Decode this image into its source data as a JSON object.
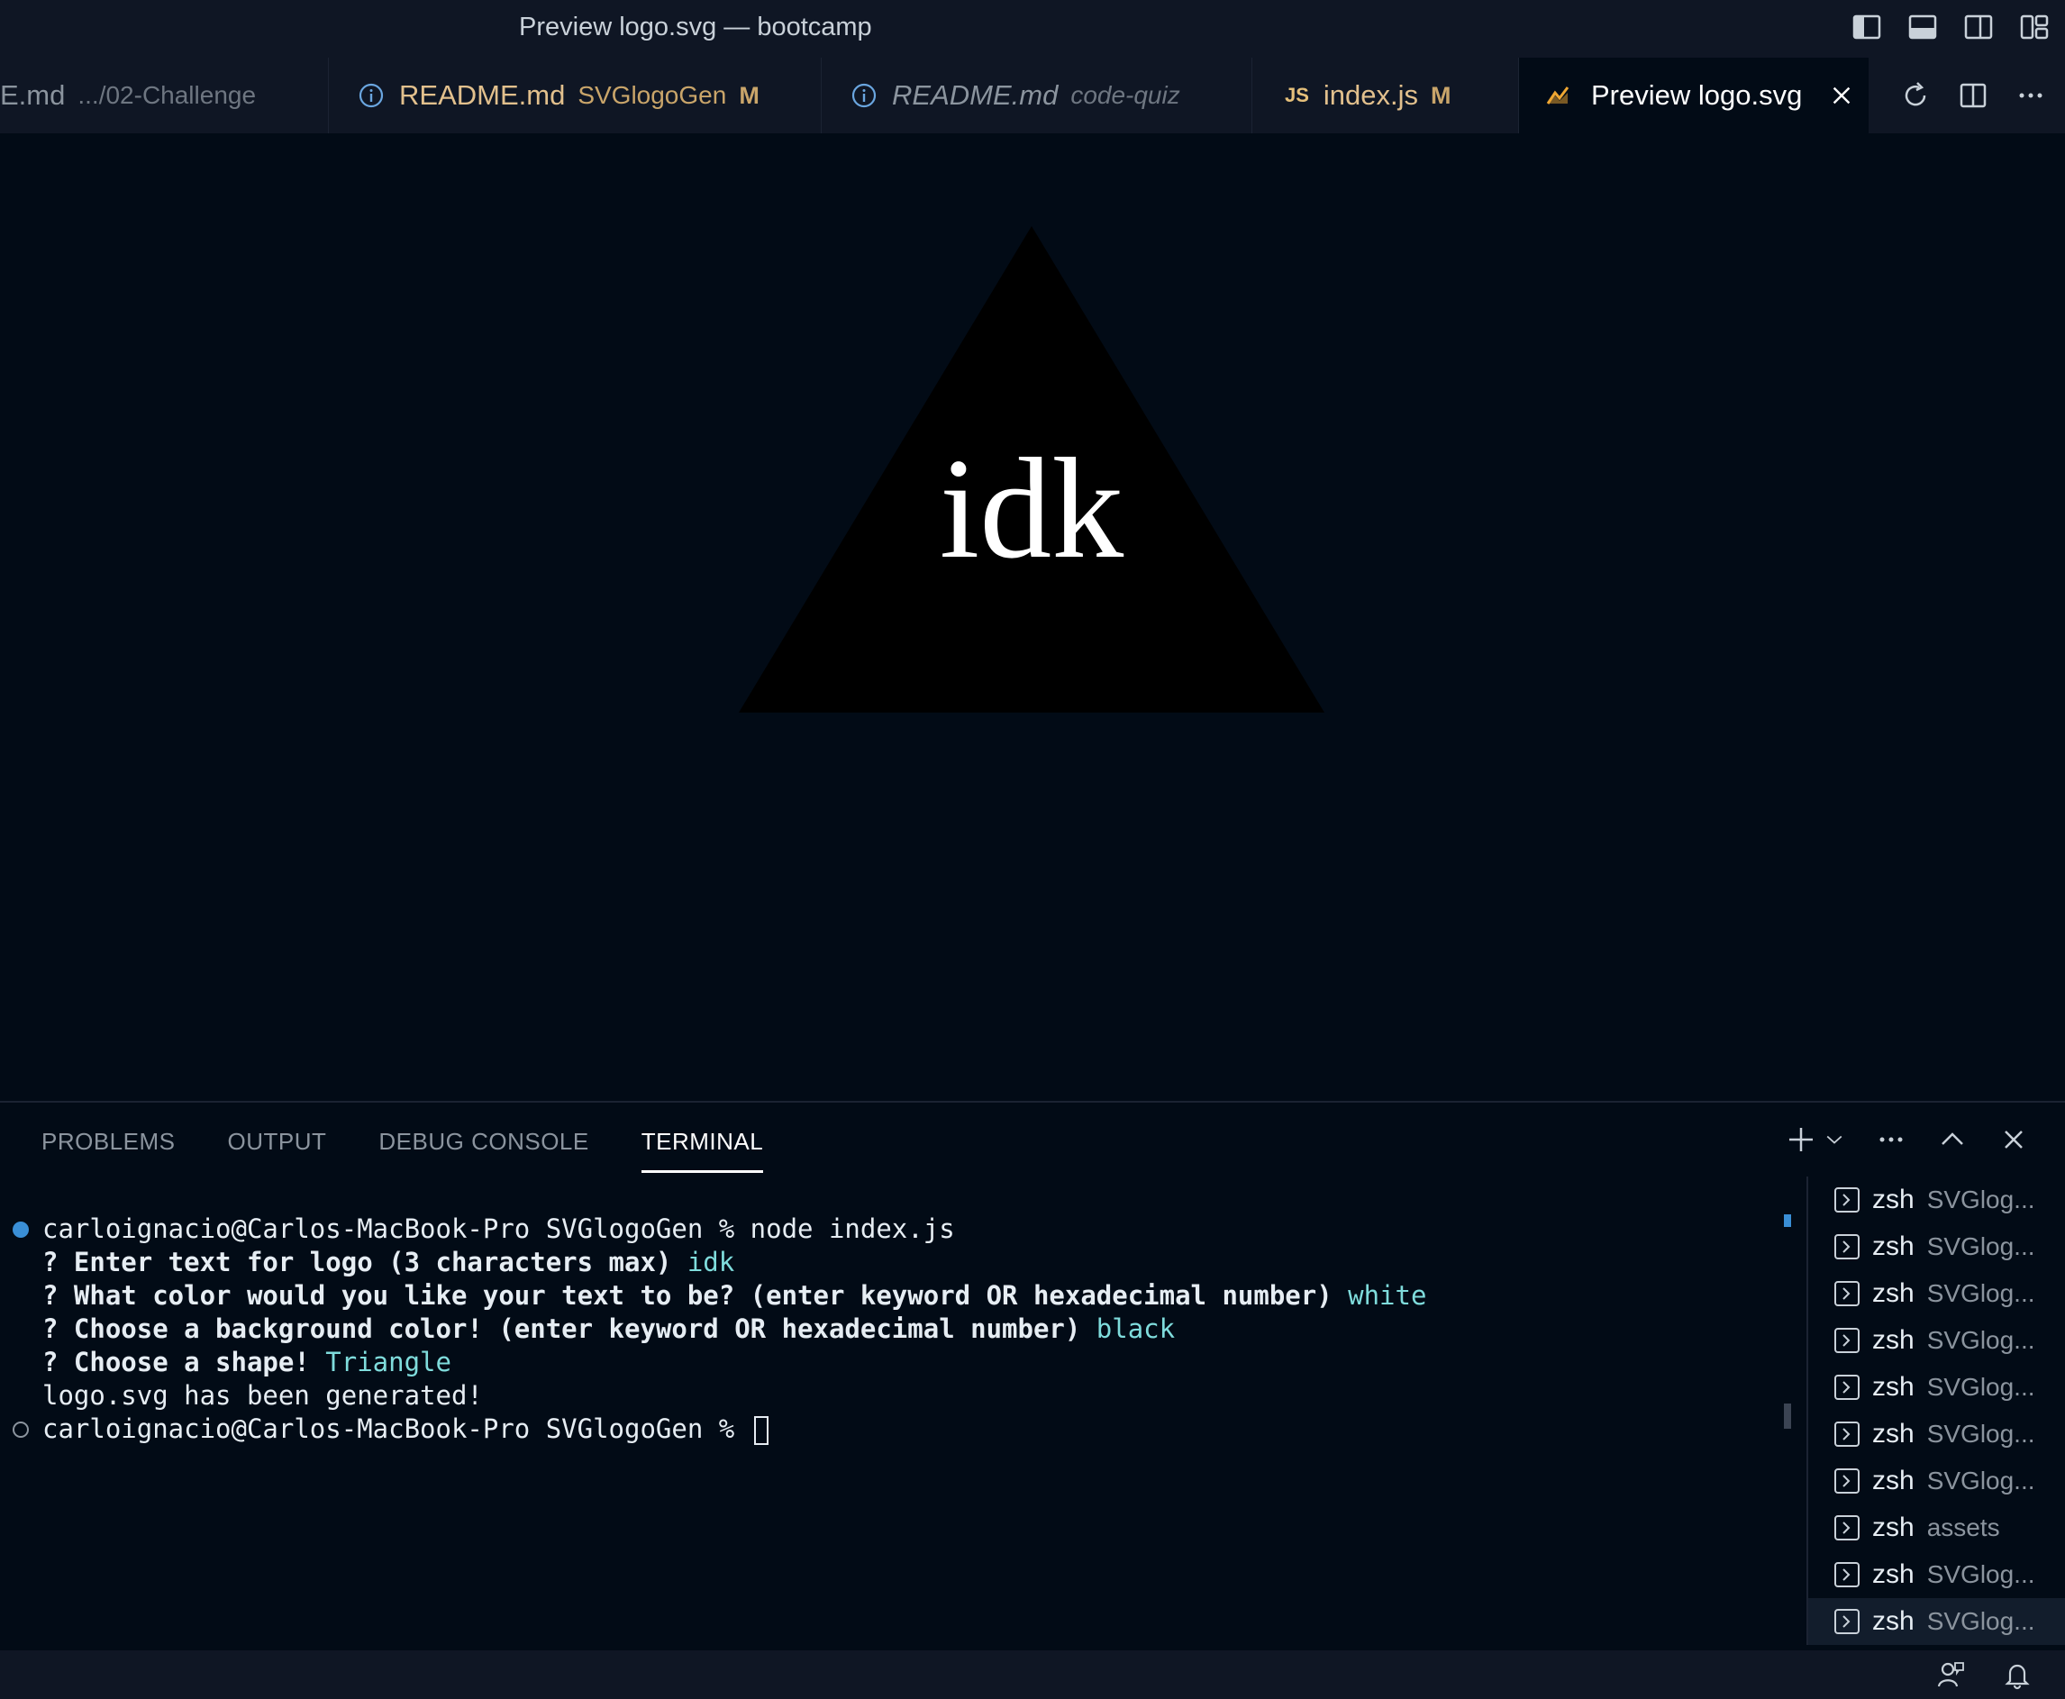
{
  "window": {
    "title": "Preview logo.svg — bootcamp",
    "layout_icons": [
      "toggle-primary-sidebar-icon",
      "toggle-panel-icon",
      "toggle-secondary-sidebar-icon",
      "customize-layout-icon"
    ]
  },
  "tabs": [
    {
      "name": "E.md",
      "desc": ".../02-Challenge",
      "modified": "",
      "icon": "none",
      "active": false,
      "italic": false
    },
    {
      "name": "README.md",
      "desc": "SVGlogoGen",
      "modified": "M",
      "icon": "info-icon",
      "active": false,
      "italic": false
    },
    {
      "name": "README.md",
      "desc": "code-quiz",
      "modified": "",
      "icon": "info-icon",
      "active": false,
      "italic": true
    },
    {
      "name": "index.js",
      "desc": "",
      "modified": "M",
      "icon": "js-icon",
      "icon_label": "JS",
      "active": false,
      "italic": false
    },
    {
      "name": "Preview logo.svg",
      "desc": "",
      "modified": "",
      "icon": "preview-icon",
      "active": true,
      "italic": false
    }
  ],
  "tab_actions": [
    "refresh-icon",
    "split-editor-icon",
    "more-actions-icon"
  ],
  "preview": {
    "logo_text": "idk",
    "shape": "Triangle",
    "shape_color": "#000000",
    "text_color": "#ffffff"
  },
  "panel": {
    "tabs": [
      "PROBLEMS",
      "OUTPUT",
      "DEBUG CONSOLE",
      "TERMINAL"
    ],
    "active_tab": "TERMINAL"
  },
  "terminal": {
    "line1_prompt": "carloignacio@Carlos-MacBook-Pro SVGlogoGen % node index.js",
    "q1": "? Enter text for logo (3 characters max) ",
    "a1": "idk",
    "q2": "? What color would you like your text to be? (enter keyword OR hexadecimal number) ",
    "a2": "white",
    "q3": "? Choose a background color! (enter keyword OR hexadecimal number) ",
    "a3": "black",
    "q4": "? Choose a shape! ",
    "a4": "Triangle",
    "result": "logo.svg has been generated!",
    "line_last_prompt": "carloignacio@Carlos-MacBook-Pro SVGlogoGen % "
  },
  "terminal_list": [
    {
      "name": "zsh",
      "cwd": "SVGlog..."
    },
    {
      "name": "zsh",
      "cwd": "SVGlog..."
    },
    {
      "name": "zsh",
      "cwd": "SVGlog..."
    },
    {
      "name": "zsh",
      "cwd": "SVGlog..."
    },
    {
      "name": "zsh",
      "cwd": "SVGlog..."
    },
    {
      "name": "zsh",
      "cwd": "SVGlog..."
    },
    {
      "name": "zsh",
      "cwd": "SVGlog..."
    },
    {
      "name": "zsh",
      "cwd": "assets"
    },
    {
      "name": "zsh",
      "cwd": "SVGlog..."
    },
    {
      "name": "zsh",
      "cwd": "SVGlog..."
    }
  ],
  "colors": {
    "accent": "#3a8fd6",
    "terminal_answer": "#7fdcdc",
    "modified": "#c9a56a"
  }
}
